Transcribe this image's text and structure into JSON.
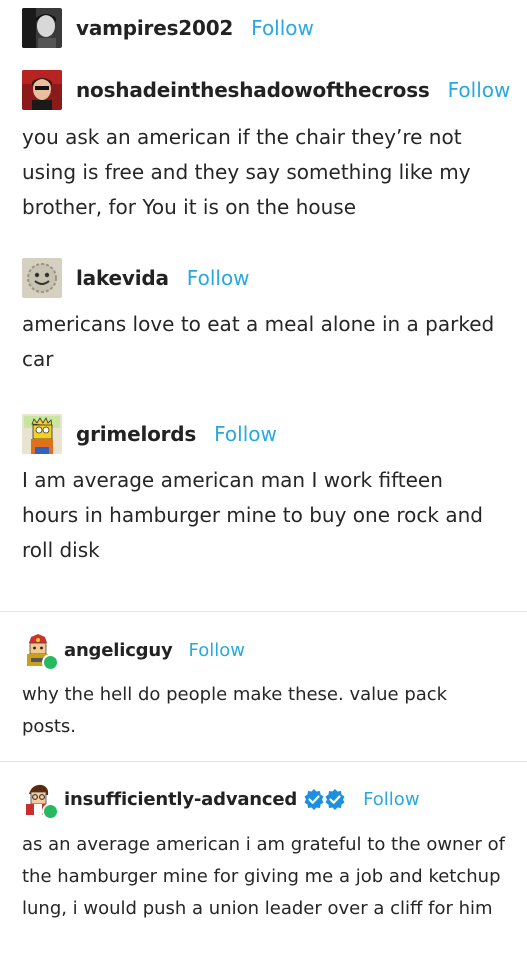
{
  "posts": [
    {
      "username": "vampires2002",
      "follow_label": "Follow",
      "avatar_icon": "grey-portrait-avatar"
    },
    {
      "username": "noshadeintheshadowofthecross",
      "follow_label": "Follow",
      "avatar_icon": "red-portrait-avatar",
      "text": "you ask an american if the chair they’re not using is free and they say something like my brother, for You it is on the house"
    },
    {
      "username": "lakevida",
      "follow_label": "Follow",
      "avatar_icon": "bottlecap-face-avatar",
      "text": "americans love to eat a meal alone in a parked car"
    },
    {
      "username": "grimelords",
      "follow_label": "Follow",
      "avatar_icon": "cartoon-character-avatar",
      "text": "I am average american man I work fifteen hours in hamburger mine to buy one rock and roll disk"
    },
    {
      "username": "angelicguy",
      "follow_label": "Follow",
      "avatar_icon": "cartoon-character-avatar",
      "text": "why the hell do people make these. value pack posts."
    },
    {
      "username": "insufficiently-advanced",
      "follow_label": "Follow",
      "avatar_icon": "cartoon-character-avatar",
      "verified_icon": "blue-check-icon",
      "text": "as an average american i am grateful to the owner of the hamburger mine for giving me a job and ketchup lung, i would push a union leader over a cliff for him"
    }
  ],
  "colors": {
    "follow": "#28a8e0",
    "text": "#262626",
    "divider": "#e4e4e4",
    "online_badge": "#28b960",
    "verified": "#1d8fe0"
  }
}
